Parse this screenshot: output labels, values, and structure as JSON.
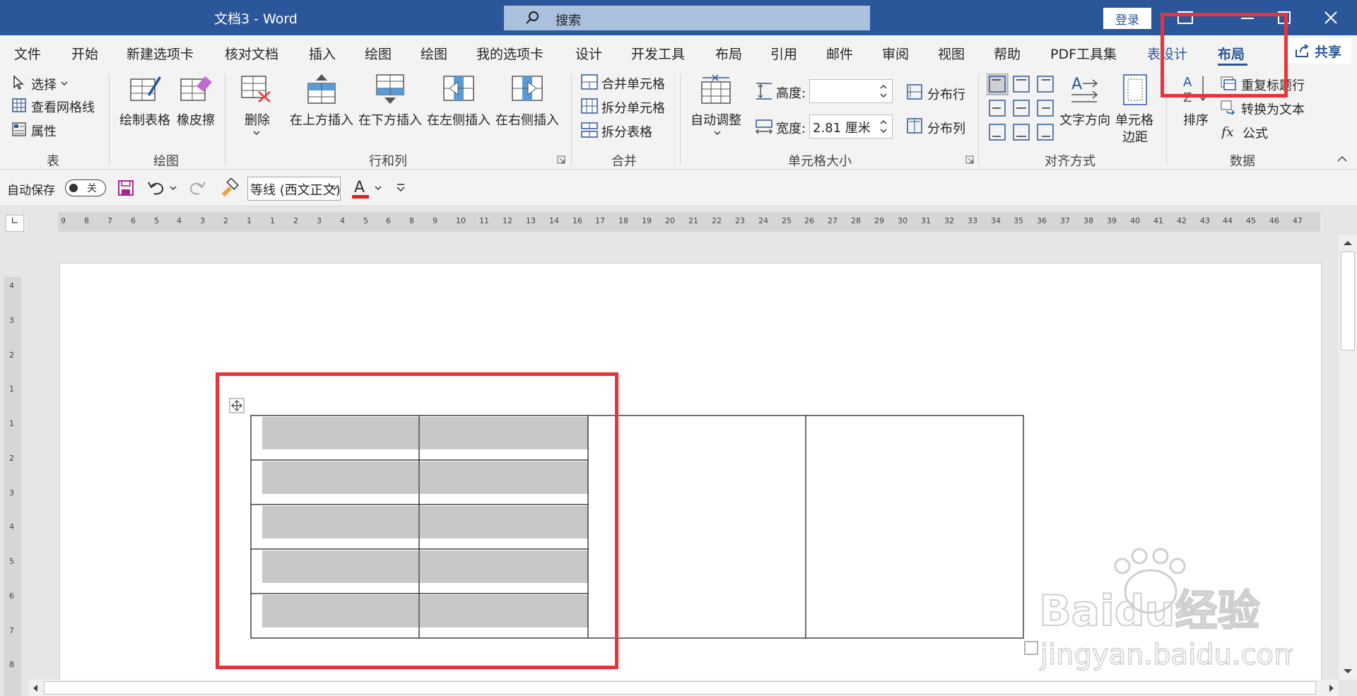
{
  "title_bar": {
    "doc_title": "文档3  -  Word",
    "search_label": "搜索",
    "login_label": "登录"
  },
  "tabs": [
    "文件",
    "开始",
    "新建选项卡",
    "核对文档",
    "插入",
    "绘图",
    "绘图",
    "我的选项卡",
    "设计",
    "开发工具",
    "布局",
    "引用",
    "邮件",
    "审阅",
    "视图",
    "帮助",
    "PDF工具集",
    "表设计",
    "布局"
  ],
  "share_label": "共享",
  "ribbon": {
    "table_group": {
      "label": "表",
      "select": "选择",
      "view_gridlines": "查看网格线",
      "properties": "属性"
    },
    "draw_group": {
      "label": "绘图",
      "draw_table": "绘制表格",
      "eraser": "橡皮擦"
    },
    "rows_cols_group": {
      "label": "行和列",
      "delete": "删除",
      "insert_above": "在上方插入",
      "insert_below": "在下方插入",
      "insert_left": "在左侧插入",
      "insert_right": "在右侧插入"
    },
    "merge_group": {
      "label": "合并",
      "merge_cells": "合并单元格",
      "split_cells": "拆分单元格",
      "split_table": "拆分表格"
    },
    "cell_size_group": {
      "label": "单元格大小",
      "autofit": "自动调整",
      "height_label": "高度:",
      "height_value": "",
      "width_label": "宽度:",
      "width_value": "2.81 厘米",
      "distribute_rows": "分布行",
      "distribute_cols": "分布列"
    },
    "alignment_group": {
      "label": "对齐方式",
      "text_direction": "文字方向",
      "cell_margins_line1": "单元格",
      "cell_margins_line2": "边距"
    },
    "data_group": {
      "label": "数据",
      "sort": "排序",
      "repeat_header": "重复标题行",
      "convert_to_text": "转换为文本",
      "formula": "公式"
    }
  },
  "qat": {
    "autosave_label": "自动保存",
    "autosave_state": "关",
    "font_name": "等线 (西文正文)"
  },
  "rulers": {
    "horizontal": [
      9,
      8,
      7,
      6,
      5,
      4,
      3,
      2,
      1,
      1,
      2,
      3,
      4,
      5,
      6,
      8,
      9,
      10,
      11,
      12,
      13,
      14,
      16,
      17,
      18,
      19,
      20,
      21,
      22,
      23,
      24,
      25,
      26,
      27,
      28,
      29,
      30,
      31,
      32,
      33,
      34,
      35,
      36,
      37,
      38,
      39,
      40,
      41,
      42,
      43,
      44,
      45,
      46,
      47
    ],
    "vertical": [
      4,
      3,
      2,
      1,
      1,
      2,
      3,
      4,
      5,
      6,
      7,
      8
    ]
  },
  "watermark": {
    "brand": "Baidu经验",
    "url": "jingyan.baidu.com"
  },
  "colors": {
    "accent": "#2b579a",
    "highlight_box": "#e8333b",
    "cell_shade": "#c8c8c8"
  }
}
